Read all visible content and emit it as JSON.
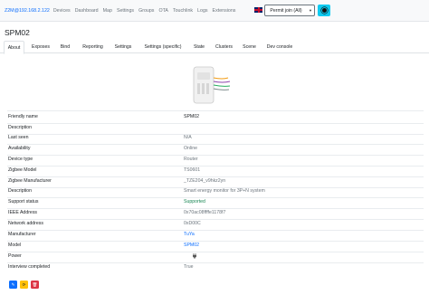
{
  "navbar": {
    "brand": "Z2M@192.168.2.122",
    "links": [
      "Devices",
      "Dashboard",
      "Map",
      "Settings",
      "Groups",
      "OTA",
      "Touchlink",
      "Logs",
      "Extensions"
    ],
    "permit_join": "Permit join (All)"
  },
  "device": {
    "title": "SPM02",
    "tabs": [
      "About",
      "Exposes",
      "Bind",
      "Reporting",
      "Settings",
      "Settings (specific)",
      "State",
      "Clusters",
      "Scene",
      "Dev console"
    ],
    "active_tab": "About"
  },
  "about": {
    "rows": [
      {
        "label": "Friendly name",
        "value": "SPM02"
      },
      {
        "label": "Description",
        "value": ""
      },
      {
        "label": "Last seen",
        "value": "N/A"
      },
      {
        "label": "Availability",
        "value": "Online"
      },
      {
        "label": "Device type",
        "value": "Router"
      },
      {
        "label": "Zigbee Model",
        "value": "TS0601"
      },
      {
        "label": "Zigbee Manufacturer",
        "value": "_TZE204_v9hkz2yn"
      },
      {
        "label": "Description",
        "value": "Smart energy monitor for 3P+N system"
      },
      {
        "label": "Support status",
        "value": "Supported"
      },
      {
        "label": "IEEE Address",
        "value": "0x70ac08ffffe1178f7"
      },
      {
        "label": "Network address",
        "value": "0xD00C"
      },
      {
        "label": "Manufacturer",
        "value": "TuYa"
      },
      {
        "label": "Model",
        "value": "SPM02"
      },
      {
        "label": "Power",
        "value": ""
      },
      {
        "label": "Interview completed",
        "value": "True"
      }
    ]
  },
  "actions": {
    "edit_icon": "pencil-icon",
    "reconfigure_icon": "refresh-icon",
    "delete_icon": "trash-icon"
  },
  "colors": {
    "primary": "#0d6efd",
    "success": "#198754",
    "warning": "#ffc107",
    "danger": "#dc3545",
    "info": "#0dcaf0"
  }
}
